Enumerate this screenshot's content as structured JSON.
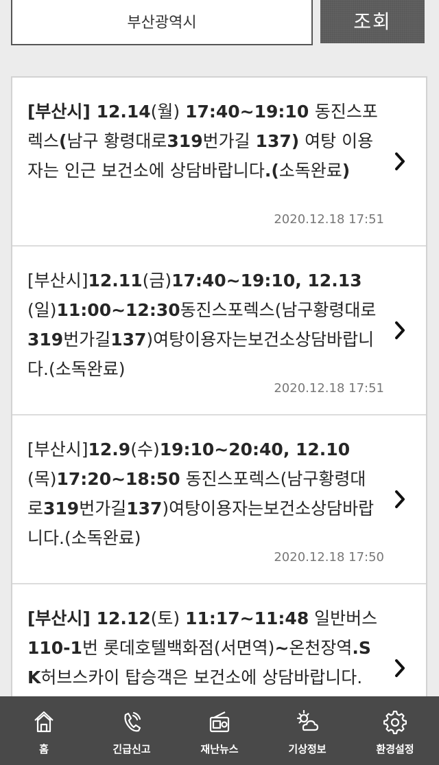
{
  "search": {
    "region_value": "부산광역시",
    "button_label": "조회"
  },
  "alerts": [
    {
      "prefix": "[부산시] ",
      "text_runs": [
        {
          "t": "12.14",
          "b": true
        },
        {
          "t": "(월) ",
          "b": false
        },
        {
          "t": "17:40~19:10 ",
          "b": true
        },
        {
          "t": "동진스포렉스",
          "b": false
        },
        {
          "t": "(",
          "b": true
        },
        {
          "t": "남구 황령대로",
          "b": false
        },
        {
          "t": "319",
          "b": true
        },
        {
          "t": "번가길 ",
          "b": false
        },
        {
          "t": "137)",
          "b": true
        },
        {
          "t": " 여탕 이용자는 인근 보건소에 상담바랍니다",
          "b": false
        },
        {
          "t": ".(",
          "b": true
        },
        {
          "t": "소독완료",
          "b": false
        },
        {
          "t": ")",
          "b": true
        }
      ],
      "timestamp": "2020.12.18 17:51"
    },
    {
      "prefix": "[부산시]",
      "text_runs": [
        {
          "t": "12.11",
          "b": true
        },
        {
          "t": "(금)",
          "b": false
        },
        {
          "t": "17:40~19:10, 12.13",
          "b": true
        },
        {
          "t": "(일)",
          "b": false
        },
        {
          "t": "11:00~12:30",
          "b": true
        },
        {
          "t": "동진스포렉스(남구황령대로",
          "b": false
        },
        {
          "t": "319",
          "b": true
        },
        {
          "t": "번가길",
          "b": false
        },
        {
          "t": "137",
          "b": true
        },
        {
          "t": ")여탕이용자는보건소상담바랍니다.(소독완료)",
          "b": false
        }
      ],
      "timestamp": "2020.12.18 17:51"
    },
    {
      "prefix": "[부산시]",
      "text_runs": [
        {
          "t": "12.9",
          "b": true
        },
        {
          "t": "(수)",
          "b": false
        },
        {
          "t": "19:10~20:40, 12.10",
          "b": true
        },
        {
          "t": "(목)",
          "b": false
        },
        {
          "t": "17:20~18:50",
          "b": true
        },
        {
          "t": " 동진스포렉스(남구황령대로",
          "b": false
        },
        {
          "t": "319",
          "b": true
        },
        {
          "t": "번가길",
          "b": false
        },
        {
          "t": "137",
          "b": true
        },
        {
          "t": ")여탕이용자는보건소상담바랍니다.(소독완료)",
          "b": false
        }
      ],
      "timestamp": "2020.12.18 17:50"
    },
    {
      "prefix": "[부산시] ",
      "text_runs": [
        {
          "t": "12.12",
          "b": true
        },
        {
          "t": "(토) ",
          "b": false
        },
        {
          "t": "11:17~11:48",
          "b": true
        },
        {
          "t": " 일반버스",
          "b": false
        },
        {
          "t": "110-1",
          "b": true
        },
        {
          "t": "번 롯데호텔백화점(서면역)",
          "b": false
        },
        {
          "t": "~",
          "b": true
        },
        {
          "t": "온천장역",
          "b": false
        },
        {
          "t": ".SK",
          "b": true
        },
        {
          "t": "허브스카이 탑승객은 보건소에 상담바랍니다.(소독완료)",
          "b": false
        }
      ],
      "timestamp": ""
    }
  ],
  "nav": {
    "items": [
      {
        "label": "홈",
        "icon": "home-icon"
      },
      {
        "label": "긴급신고",
        "icon": "phone-icon"
      },
      {
        "label": "재난뉴스",
        "icon": "radio-icon"
      },
      {
        "label": "기상정보",
        "icon": "weather-icon"
      },
      {
        "label": "환경설정",
        "icon": "gear-icon"
      }
    ]
  },
  "colors": {
    "background": "#ececec",
    "button": "#5a5a5a",
    "nav": "#494949",
    "timestamp": "#777777"
  }
}
